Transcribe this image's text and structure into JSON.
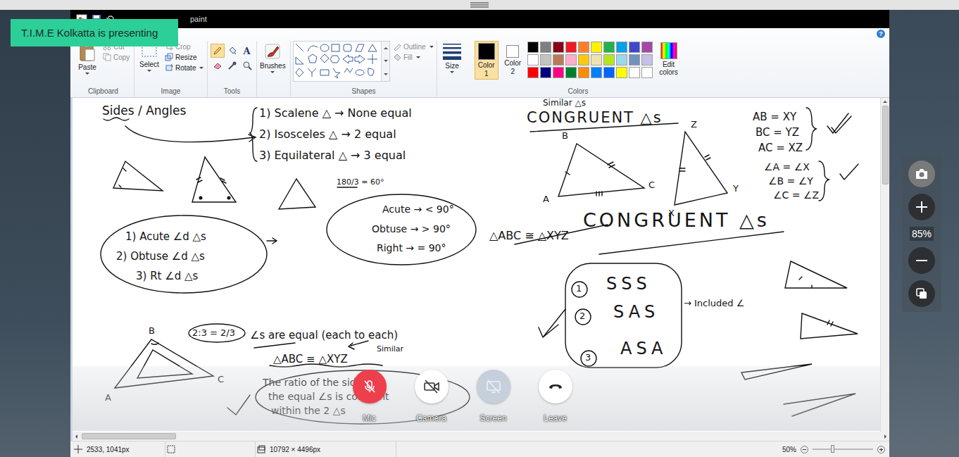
{
  "presenter_badge": "T.I.M.E Kolkatta is presenting",
  "window": {
    "title": "paint"
  },
  "ribbon": {
    "help": "?",
    "clipboard": {
      "label": "Clipboard",
      "paste": "Paste",
      "items": [
        {
          "label": "Cut",
          "disabled": true
        },
        {
          "label": "Copy",
          "disabled": true
        }
      ]
    },
    "image": {
      "label": "Image",
      "select": "Select",
      "items": [
        {
          "label": "Crop",
          "disabled": true
        },
        {
          "label": "Resize",
          "disabled": false
        },
        {
          "label": "Rotate",
          "disabled": false
        }
      ]
    },
    "tools": {
      "label": "Tools",
      "items": [
        {
          "kind": "pencil",
          "selected": true
        },
        {
          "kind": "fill",
          "selected": false
        },
        {
          "kind": "text",
          "label": "A",
          "selected": false
        },
        {
          "kind": "eraser",
          "selected": false
        },
        {
          "kind": "picker",
          "selected": false
        },
        {
          "kind": "magnifier",
          "selected": false
        }
      ]
    },
    "brushes": {
      "label": "Brushes"
    },
    "shapes": {
      "label": "Shapes",
      "items": [
        {
          "label": "Outline",
          "disabled": true
        },
        {
          "label": "Fill",
          "disabled": true
        }
      ]
    },
    "size": {
      "label": "Size"
    },
    "colors": {
      "label": "Colors",
      "slots": [
        {
          "label": "Color 1",
          "selected": true,
          "color": "#000000"
        },
        {
          "label": "Color 2",
          "selected": false,
          "color": "#ffffff"
        }
      ],
      "palette": [
        {
          "color": "#000000"
        },
        {
          "color": "#7f7f7f"
        },
        {
          "color": "#880015"
        },
        {
          "color": "#ed1c24"
        },
        {
          "color": "#ff7f27"
        },
        {
          "color": "#fff200"
        },
        {
          "color": "#22b14c"
        },
        {
          "color": "#00a2e8"
        },
        {
          "color": "#3f48cc"
        },
        {
          "color": "#a349a4"
        },
        {
          "color": "#ffffff"
        },
        {
          "color": "#c3c3c3"
        },
        {
          "color": "#b97a57"
        },
        {
          "color": "#ffaec9"
        },
        {
          "color": "#ffc90e"
        },
        {
          "color": "#efe4b0"
        },
        {
          "color": "#b5e61d"
        },
        {
          "color": "#99d9ea"
        },
        {
          "color": "#7092be"
        },
        {
          "color": "#c8bfe7"
        },
        {
          "color": "#ff0000"
        },
        {
          "color": "#000080"
        },
        {
          "color": "#ff0080"
        },
        {
          "color": "#00802b"
        },
        {
          "color": "#ff8c00"
        },
        {
          "color": "#0080ff"
        },
        {
          "color": "#0066ff"
        },
        {
          "color": "#ffff00"
        },
        {
          "color": "#ffffff"
        },
        {
          "color": "#ffffff"
        }
      ],
      "edit": "Edit colors"
    }
  },
  "whiteboard": {
    "notes": [
      "Sides / Angles",
      "1) Scalene △ → None equal",
      "2) Isosceles △ → 2 equal",
      "3) Equilateral △ → 3 equal",
      "180/3 = 60°",
      "Acute → < 90°",
      "Obtuse → > 90°",
      "Right → = 90°",
      "1) Acute ∠d △s",
      "2) Obtuse ∠d △s",
      "3) Rt ∠d △s",
      "Similar △s",
      "CONGRUENT △s",
      "AB = XY",
      "BC = YZ",
      "AC = XZ",
      "∠A = ∠X",
      "∠B = ∠Y",
      "∠C = ∠Z",
      "△ABC ≅ △XYZ",
      "CONGRUENT △s",
      "SSS",
      "SAS",
      "ASA",
      "→ Included ∠",
      "2:3 = 2/3",
      "∠s are equal (each to each)",
      "Similar",
      "△ABC ≡ △XYZ",
      "The ratio of the sides of",
      "the equal ∠s is constant",
      "within the 2 △s"
    ],
    "labels": [
      "B",
      "A",
      "C",
      "Z",
      "X",
      "Y",
      "B",
      "A",
      "C",
      "1",
      "2",
      "3"
    ]
  },
  "status_bar": {
    "cursor": "2533, 1041px",
    "size": "10792 × 4496px",
    "zoom": "50%",
    "zoom_level": 0.3
  },
  "zoom_panel": {
    "zoom": "85%"
  },
  "call_controls": [
    {
      "label": "Mic",
      "kind": "mic",
      "on": false,
      "disabled": false
    },
    {
      "label": "Camera",
      "kind": "camera",
      "on": false,
      "disabled": false
    },
    {
      "label": "Screen",
      "kind": "screen",
      "on": false,
      "disabled": true
    },
    {
      "label": "Leave",
      "kind": "leave",
      "on": true,
      "disabled": false
    }
  ]
}
